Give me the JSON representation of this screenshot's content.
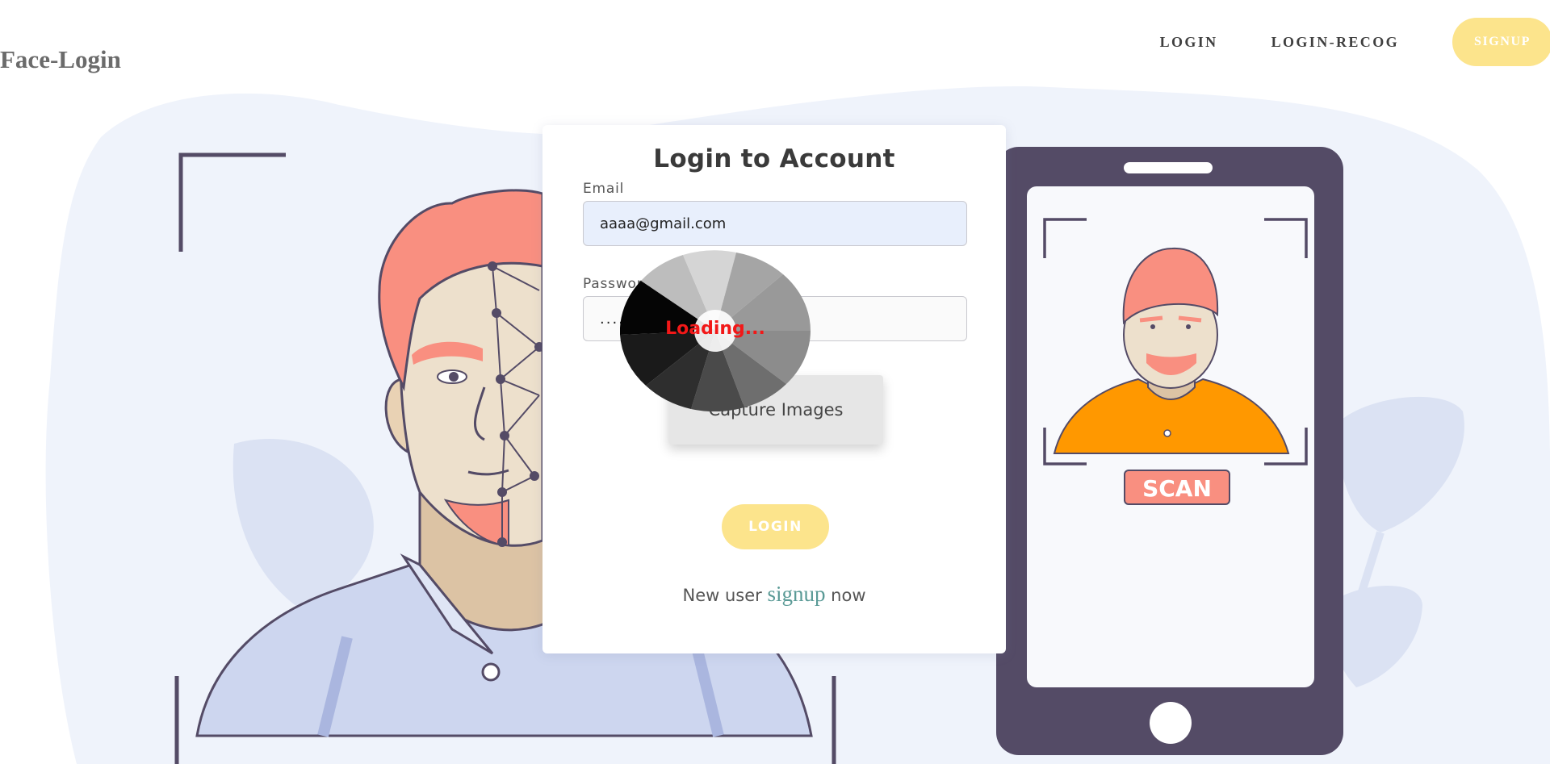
{
  "brand": {
    "name": "Face-Login"
  },
  "nav": {
    "login": "LOGIN",
    "login_recog": "LOGIN-RECOG",
    "signup": "SIGNUP"
  },
  "form": {
    "title": "Login to Account",
    "email_label": "Email",
    "email_value": "aaaa@gmail.com",
    "password_label": "Password",
    "password_value": "........",
    "capture_button": "Capture Images",
    "login_button": "LOGIN",
    "signup_prefix": "New user",
    "signup_link": "signup",
    "signup_suffix": "now"
  },
  "loader": {
    "text": "Loading..."
  },
  "phone": {
    "scan_label": "SCAN"
  },
  "colors": {
    "accent_yellow": "#fce48c",
    "phone_frame": "#544b66",
    "scan_badge": "#f98f80",
    "hair": "#f98f80",
    "shirt_orange": "#ff9800",
    "blob_bg": "#eff3fb",
    "link_teal": "#5a9a96",
    "loading_red": "#f21818"
  }
}
